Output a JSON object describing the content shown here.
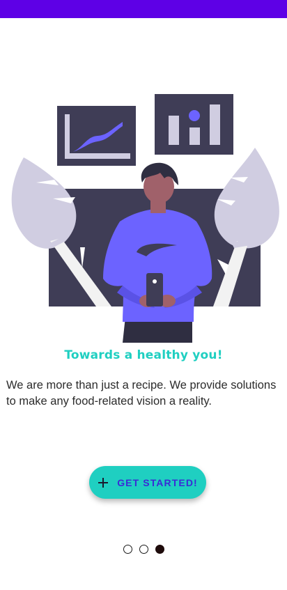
{
  "colors": {
    "status_bar": "#5e00e6",
    "accent_teal": "#1fcfc1",
    "button_label": "#3a2bd6",
    "text": "#2b2b2b",
    "illustration_dark": "#3f3d56",
    "illustration_purple": "#6c63ff",
    "illustration_lavender": "#d0cde1",
    "dot_active": "#1e0b0b"
  },
  "onboarding": {
    "illustration_icon": "person-with-phone-illustration",
    "headline": "Towards a healthy you!",
    "body": "We are more than just a recipe. We provide solutions to make any food-related vision a reality.",
    "button": {
      "icon": "plus-icon",
      "label": "GET STARTED!"
    },
    "pager": {
      "count": 3,
      "active_index": 2
    }
  }
}
